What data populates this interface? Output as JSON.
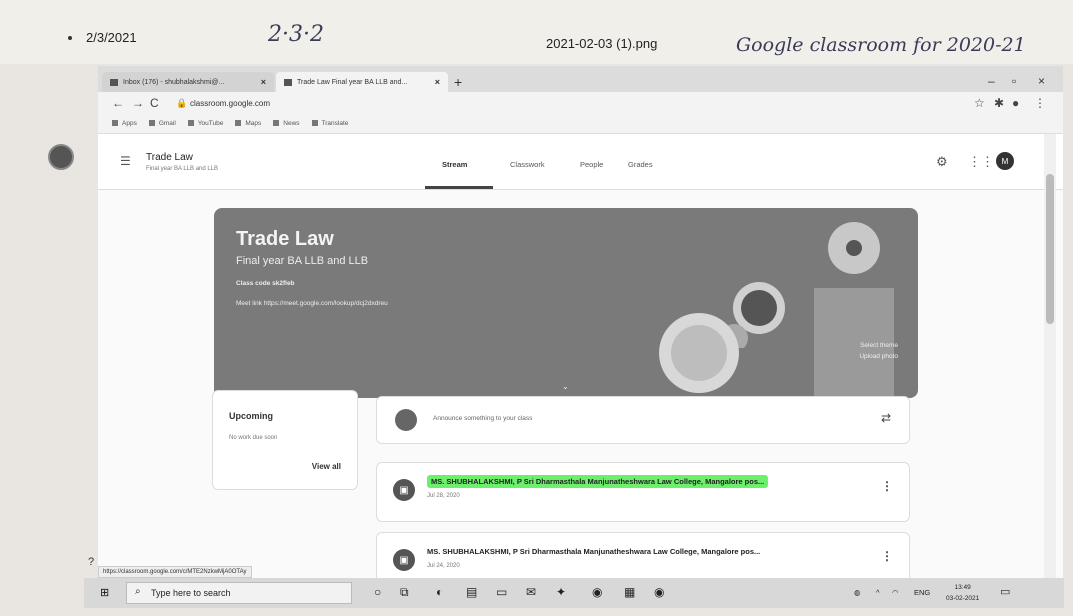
{
  "paper": {
    "date": "2/3/2021",
    "handwritten_left": "2·3·2",
    "filename": "2021-02-03 (1).png",
    "handwritten_right": "Google classroom for 2020-21"
  },
  "browser": {
    "tabs": [
      {
        "label": "Inbox (176) - shubhalakshmi@..."
      },
      {
        "label": "Trade Law Final year BA LLB and..."
      }
    ],
    "new_tab": "+",
    "url": "classroom.google.com",
    "bookmarks": [
      "Apps",
      "Gmail",
      "YouTube",
      "Maps",
      "News",
      "Translate"
    ]
  },
  "classroom": {
    "class_name": "Trade Law",
    "class_section": "Final year BA LLB and LLB",
    "tabs": [
      "Stream",
      "Classwork",
      "People",
      "Grades"
    ],
    "avatar_letter": "M"
  },
  "banner": {
    "title": "Trade Law",
    "subtitle": "Final year BA LLB and LLB",
    "class_code": "Class code  sk2fleb",
    "meet_link": "Meet link  https://meet.google.com/lookup/dcj2dxdreu",
    "select_theme": "Select theme",
    "upload_photo": "Upload photo"
  },
  "upcoming": {
    "title": "Upcoming",
    "none": "No work due soon",
    "view_all": "View all"
  },
  "announce": {
    "placeholder": "Announce something to your class"
  },
  "posts": [
    {
      "author": "MS. SHUBHALAKSHMI, P Sri Dharmasthala Manjunatheshwara Law College, Mangalore pos...",
      "date": "Jul 28, 2020"
    },
    {
      "author": "MS. SHUBHALAKSHMI, P Sri Dharmasthala Manjunatheshwara Law College, Mangalore pos...",
      "date": "Jul 24, 2020"
    }
  ],
  "status_url": "https://classroom.google.com/c/MTE2NzkwMjA0OTAy",
  "taskbar": {
    "search": "Type here to search",
    "lang": "ENG",
    "time": "13:49",
    "date": "03-02-2021"
  }
}
